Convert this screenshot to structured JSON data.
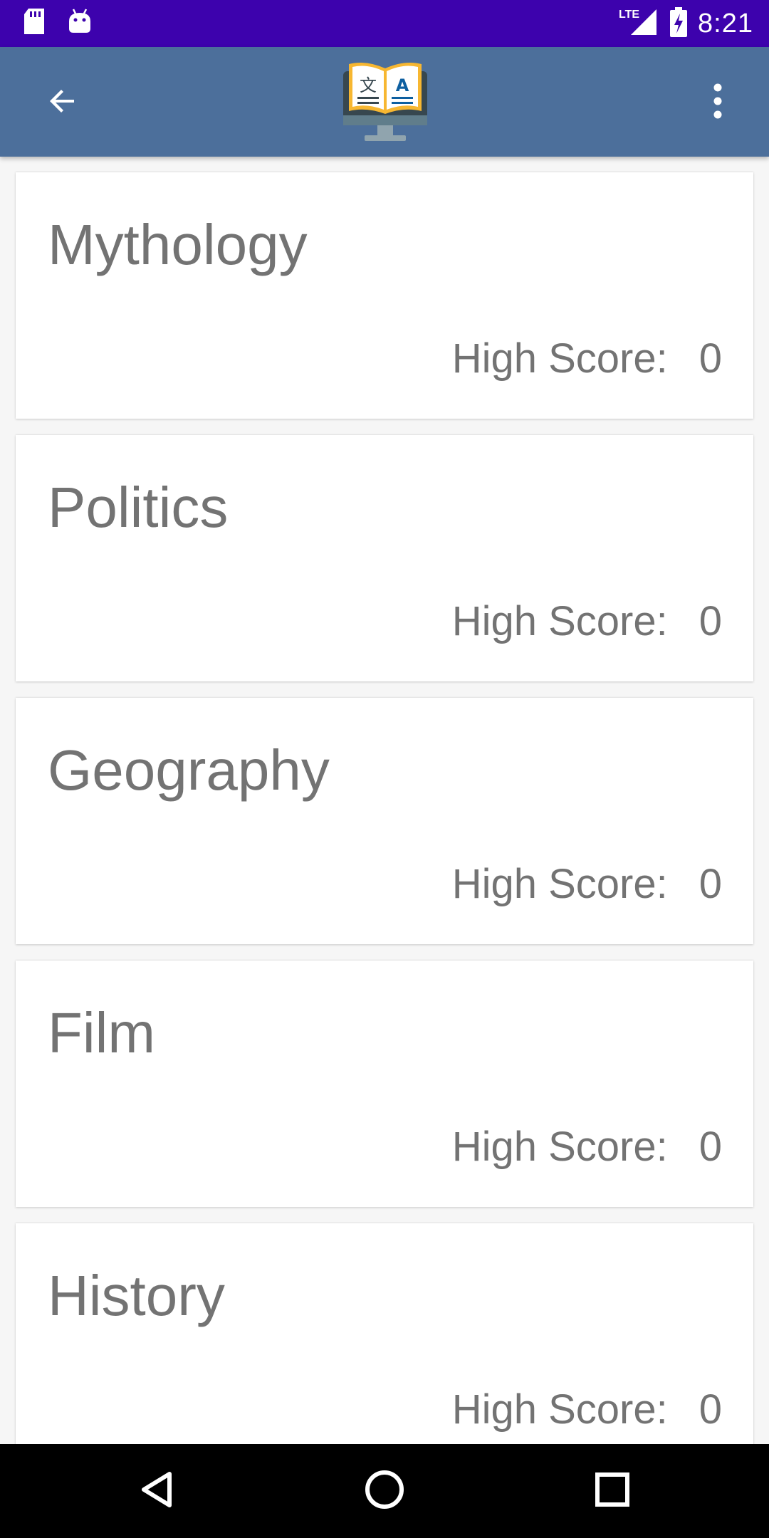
{
  "status_bar": {
    "time": "8:21",
    "network": "LTE",
    "left_icons": [
      "sd-card-icon",
      "android-debug-icon"
    ],
    "right_icons": [
      "signal-icon",
      "battery-charging-icon"
    ]
  },
  "app_bar": {
    "back_icon": "arrow-back-icon",
    "logo_icon": "dictionary-book-monitor-logo",
    "menu_icon": "more-vert-icon"
  },
  "categories": [
    {
      "title": "Mythology",
      "score_label": "High Score:",
      "score": "0"
    },
    {
      "title": "Politics",
      "score_label": "High Score:",
      "score": "0"
    },
    {
      "title": "Geography",
      "score_label": "High Score:",
      "score": "0"
    },
    {
      "title": "Film",
      "score_label": "High Score:",
      "score": "0"
    },
    {
      "title": "History",
      "score_label": "High Score:",
      "score": "0"
    }
  ],
  "nav_bar": {
    "icons": [
      "nav-back-icon",
      "nav-home-icon",
      "nav-recents-icon"
    ]
  },
  "colors": {
    "status_bar": "#3d02ad",
    "app_bar": "#4c6f9b",
    "text": "#737373",
    "background": "#f6f6f6"
  }
}
